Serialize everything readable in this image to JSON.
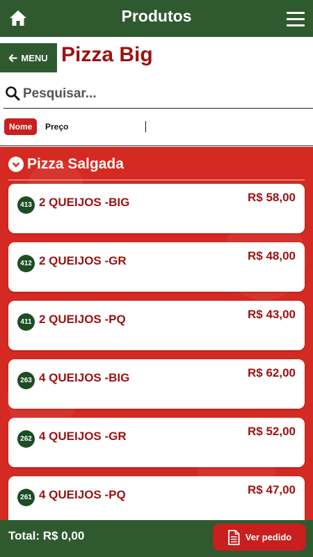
{
  "header": {
    "title": "Produtos",
    "home_icon": "home-icon",
    "menu_icon": "hamburger-menu-icon"
  },
  "store": {
    "back_label": "MENU",
    "name": "Pizza Big"
  },
  "search": {
    "placeholder": "Pesquisar...",
    "value": ""
  },
  "sort": {
    "name_label": "Nome",
    "price_label": "Preço"
  },
  "category": {
    "name": "Pizza Salgada"
  },
  "products": [
    {
      "code": "413",
      "name": "2 QUEIJOS -BIG",
      "price": "R$ 58,00"
    },
    {
      "code": "412",
      "name": "2 QUEIJOS -GR",
      "price": "R$ 48,00"
    },
    {
      "code": "411",
      "name": "2 QUEIJOS -PQ",
      "price": "R$ 43,00"
    },
    {
      "code": "263",
      "name": "4 QUEIJOS -BIG",
      "price": "R$ 62,00"
    },
    {
      "code": "262",
      "name": "4 QUEIJOS -GR",
      "price": "R$ 52,00"
    },
    {
      "code": "261",
      "name": "4 QUEIJOS -PQ",
      "price": "R$ 47,00"
    }
  ],
  "footer": {
    "total": "Total: R$ 0,00",
    "order_label": "Ver pedido"
  },
  "colors": {
    "primary_green": "#2f5a2f",
    "brand_red": "#9c1111",
    "background_red": "#d42a22",
    "badge_green": "#1d4d23"
  }
}
